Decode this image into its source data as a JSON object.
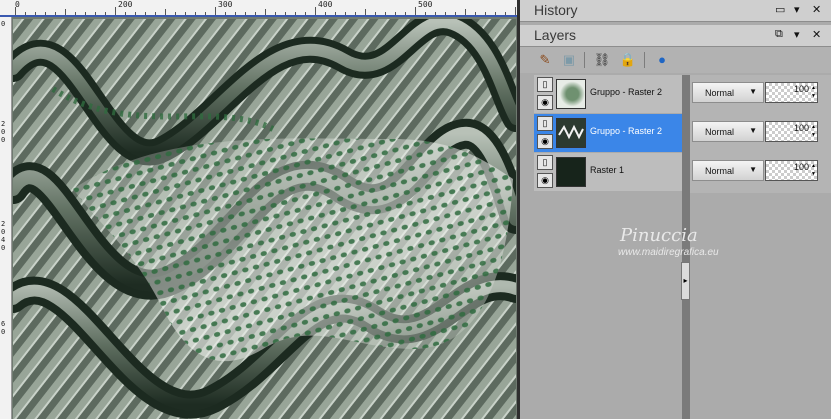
{
  "canvas": {
    "ruler_top_ticks": [
      "0",
      "200",
      "300",
      "400",
      "500"
    ],
    "ruler_left_ticks": [
      "0",
      "2",
      "0",
      "0",
      "2",
      "0",
      "4",
      "0",
      "6",
      "0"
    ],
    "image": "green-halftone-wave-artwork"
  },
  "history_panel": {
    "title": "History",
    "buttons": [
      "restore-icon",
      "dropdown-icon",
      "close-icon"
    ]
  },
  "layers_panel": {
    "title": "Layers",
    "buttons": [
      "restore-icon",
      "dropdown-icon",
      "close-icon"
    ],
    "toolbar": [
      "brush-icon",
      "mask-icon",
      "link-icon",
      "lock-icon",
      "globe-icon"
    ],
    "layers": [
      {
        "name": "Gruppo - Raster 2",
        "blend_mode": "Normal",
        "opacity": "100",
        "selected": false,
        "thumb_color": "#8aa88c"
      },
      {
        "name": "Gruppo - Raster 2",
        "blend_mode": "Normal",
        "opacity": "100",
        "selected": true,
        "thumb_color": "#2c3a30"
      },
      {
        "name": "Raster 1",
        "blend_mode": "Normal",
        "opacity": "100",
        "selected": false,
        "thumb_color": "#17241b"
      }
    ]
  },
  "watermark": {
    "line1": "Pinuccia",
    "line2": "www.maidiregrafica.eu"
  },
  "colors": {
    "selected_row": "#3b86e8",
    "panel_bg": "#ababab",
    "ruler_border": "#3a59b0"
  }
}
